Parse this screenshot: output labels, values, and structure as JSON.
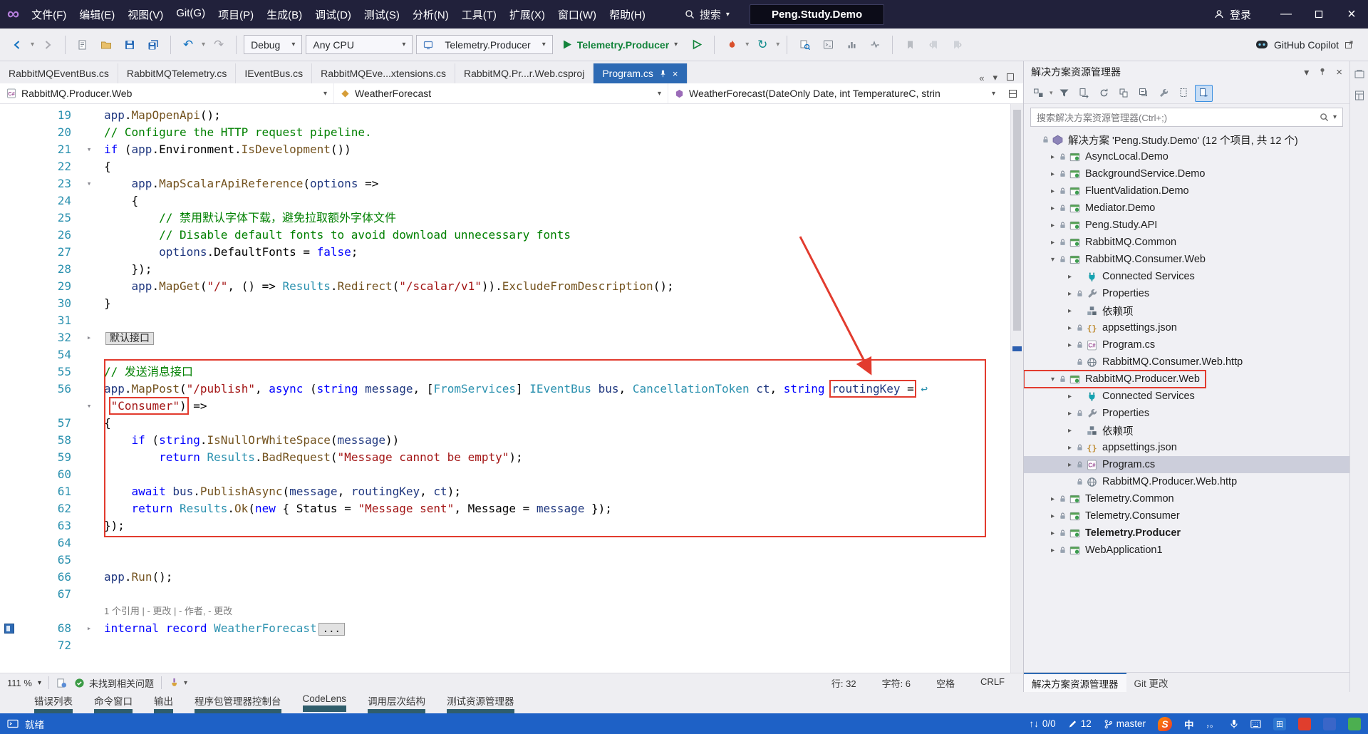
{
  "title_bar": {
    "menus": [
      "文件(F)",
      "编辑(E)",
      "视图(V)",
      "Git(G)",
      "项目(P)",
      "生成(B)",
      "调试(D)",
      "测试(S)",
      "分析(N)",
      "工具(T)",
      "扩展(X)",
      "窗口(W)",
      "帮助(H)"
    ],
    "search_label": "搜索",
    "solution_badge": "Peng.Study.Demo",
    "sign_in_label": "登录"
  },
  "toolbar": {
    "configuration": "Debug",
    "platform": "Any CPU",
    "profile": "Telemetry.Producer",
    "start_label": "Telemetry.Producer",
    "copilot_label": "GitHub Copilot"
  },
  "document_tabs": [
    {
      "label": "RabbitMQEventBus.cs"
    },
    {
      "label": "RabbitMQTelemetry.cs"
    },
    {
      "label": "IEventBus.cs"
    },
    {
      "label": "RabbitMQEve...xtensions.cs"
    },
    {
      "label": "RabbitMQ.Pr...r.Web.csproj"
    },
    {
      "label": "Program.cs",
      "active": true
    }
  ],
  "navbar": {
    "project": "RabbitMQ.Producer.Web",
    "type": "WeatherForecast",
    "member": "WeatherForecast(DateOnly Date, int TemperatureC, strin"
  },
  "editor": {
    "lines": [
      {
        "n": "19",
        "t": [
          [
            "v",
            "app"
          ],
          [
            "pl",
            "."
          ],
          [
            "m",
            "MapOpenApi"
          ],
          [
            "pl",
            "();"
          ]
        ]
      },
      {
        "n": "20",
        "t": [
          [
            "c",
            "// Configure the HTTP request pipeline."
          ]
        ]
      },
      {
        "n": "21",
        "f": "e",
        "t": [
          [
            "k",
            "if"
          ],
          [
            "pl",
            " ("
          ],
          [
            "v",
            "app"
          ],
          [
            "pl",
            ".Environment."
          ],
          [
            "m",
            "IsDevelopment"
          ],
          [
            "pl",
            "())"
          ]
        ]
      },
      {
        "n": "22",
        "t": [
          [
            "pl",
            "{"
          ]
        ]
      },
      {
        "n": "23",
        "f": "e",
        "t": [
          [
            "pl",
            "    "
          ],
          [
            "v",
            "app"
          ],
          [
            "pl",
            "."
          ],
          [
            "m",
            "MapScalarApiReference"
          ],
          [
            "pl",
            "("
          ],
          [
            "v",
            "options"
          ],
          [
            "pl",
            " =>"
          ]
        ]
      },
      {
        "n": "24",
        "t": [
          [
            "pl",
            "    {"
          ]
        ]
      },
      {
        "n": "25",
        "t": [
          [
            "pl",
            "        "
          ],
          [
            "c",
            "// 禁用默认字体下载，避免拉取额外字体文件"
          ]
        ]
      },
      {
        "n": "26",
        "t": [
          [
            "pl",
            "        "
          ],
          [
            "c",
            "// Disable default fonts to avoid download unnecessary fonts"
          ]
        ]
      },
      {
        "n": "27",
        "t": [
          [
            "pl",
            "        "
          ],
          [
            "v",
            "options"
          ],
          [
            "pl",
            ".DefaultFonts = "
          ],
          [
            "k",
            "false"
          ],
          [
            "pl",
            ";"
          ]
        ]
      },
      {
        "n": "28",
        "t": [
          [
            "pl",
            "    });"
          ]
        ]
      },
      {
        "n": "29",
        "t": [
          [
            "pl",
            "    "
          ],
          [
            "v",
            "app"
          ],
          [
            "pl",
            "."
          ],
          [
            "m",
            "MapGet"
          ],
          [
            "pl",
            "("
          ],
          [
            "s",
            "\"/\""
          ],
          [
            "pl",
            ", () => "
          ],
          [
            "t",
            "Results"
          ],
          [
            "pl",
            "."
          ],
          [
            "m",
            "Redirect"
          ],
          [
            "pl",
            "("
          ],
          [
            "s",
            "\"/scalar/v1\""
          ],
          [
            "pl",
            "))."
          ],
          [
            "m",
            "ExcludeFromDescription"
          ],
          [
            "pl",
            "();"
          ]
        ]
      },
      {
        "n": "30",
        "t": [
          [
            "pl",
            "}"
          ]
        ]
      },
      {
        "n": "31",
        "t": []
      },
      {
        "n": "32",
        "f": "c",
        "t": [
          [
            "collapsed",
            "默认接口"
          ]
        ]
      },
      {
        "n": "54",
        "t": []
      },
      {
        "n": "55",
        "t": [
          [
            "c",
            "// 发送消息接口"
          ]
        ]
      },
      {
        "n": "56",
        "t": [
          [
            "v",
            "app"
          ],
          [
            "pl",
            "."
          ],
          [
            "m",
            "MapPost"
          ],
          [
            "pl",
            "("
          ],
          [
            "s",
            "\"/publish\""
          ],
          [
            "pl",
            ", "
          ],
          [
            "k",
            "async"
          ],
          [
            "pl",
            " ("
          ],
          [
            "k",
            "string"
          ],
          [
            "pl",
            " "
          ],
          [
            "v",
            "message"
          ],
          [
            "pl",
            ", ["
          ],
          [
            "t",
            "FromServices"
          ],
          [
            "pl",
            "] "
          ],
          [
            "t",
            "IEventBus"
          ],
          [
            "pl",
            " "
          ],
          [
            "v",
            "bus"
          ],
          [
            "pl",
            ", "
          ],
          [
            "t",
            "CancellationToken"
          ],
          [
            "pl",
            " "
          ],
          [
            "v",
            "ct"
          ],
          [
            "pl",
            ", "
          ],
          [
            "k",
            "string"
          ],
          [
            "pl",
            " "
          ],
          [
            "BOX",
            [
              [
                "v",
                "routingKey"
              ],
              [
                "pl",
                " ="
              ]
            ]
          ],
          [
            "wr",
            " ↩"
          ]
        ]
      },
      {
        "n": "",
        "f": "e",
        "t": [
          [
            "pl",
            " "
          ],
          [
            "BOX",
            [
              [
                "s",
                "\"Consumer\""
              ],
              [
                "pl",
                ")"
              ]
            ]
          ],
          [
            "pl",
            " =>"
          ]
        ]
      },
      {
        "n": "57",
        "t": [
          [
            "pl",
            "{"
          ]
        ]
      },
      {
        "n": "58",
        "t": [
          [
            "pl",
            "    "
          ],
          [
            "k",
            "if"
          ],
          [
            "pl",
            " ("
          ],
          [
            "k",
            "string"
          ],
          [
            "pl",
            "."
          ],
          [
            "m",
            "IsNullOrWhiteSpace"
          ],
          [
            "pl",
            "("
          ],
          [
            "v",
            "message"
          ],
          [
            "pl",
            "))"
          ]
        ]
      },
      {
        "n": "59",
        "t": [
          [
            "pl",
            "        "
          ],
          [
            "k",
            "return"
          ],
          [
            "pl",
            " "
          ],
          [
            "t",
            "Results"
          ],
          [
            "pl",
            "."
          ],
          [
            "m",
            "BadRequest"
          ],
          [
            "pl",
            "("
          ],
          [
            "s",
            "\"Message cannot be empty\""
          ],
          [
            "pl",
            ");"
          ]
        ]
      },
      {
        "n": "60",
        "t": []
      },
      {
        "n": "61",
        "t": [
          [
            "pl",
            "    "
          ],
          [
            "k",
            "await"
          ],
          [
            "pl",
            " "
          ],
          [
            "v",
            "bus"
          ],
          [
            "pl",
            "."
          ],
          [
            "m",
            "PublishAsync"
          ],
          [
            "pl",
            "("
          ],
          [
            "v",
            "message"
          ],
          [
            "pl",
            ", "
          ],
          [
            "v",
            "routingKey"
          ],
          [
            "pl",
            ", "
          ],
          [
            "v",
            "ct"
          ],
          [
            "pl",
            ");"
          ]
        ]
      },
      {
        "n": "62",
        "t": [
          [
            "pl",
            "    "
          ],
          [
            "k",
            "return"
          ],
          [
            "pl",
            " "
          ],
          [
            "t",
            "Results"
          ],
          [
            "pl",
            "."
          ],
          [
            "m",
            "Ok"
          ],
          [
            "pl",
            "("
          ],
          [
            "k",
            "new"
          ],
          [
            "pl",
            " { Status = "
          ],
          [
            "s",
            "\"Message sent\""
          ],
          [
            "pl",
            ", Message = "
          ],
          [
            "v",
            "message"
          ],
          [
            "pl",
            " });"
          ]
        ]
      },
      {
        "n": "63",
        "t": [
          [
            "pl",
            "});"
          ]
        ]
      },
      {
        "n": "64",
        "t": []
      },
      {
        "n": "65",
        "t": []
      },
      {
        "n": "66",
        "t": [
          [
            "v",
            "app"
          ],
          [
            "pl",
            "."
          ],
          [
            "m",
            "Run"
          ],
          [
            "pl",
            "();"
          ]
        ]
      },
      {
        "n": "67",
        "t": []
      },
      {
        "lens": "1 个引用 | - 更改 | - 作者, - 更改"
      },
      {
        "n": "68",
        "f": "c",
        "mark": true,
        "t": [
          [
            "k",
            "internal"
          ],
          [
            "pl",
            " "
          ],
          [
            "k",
            "record"
          ],
          [
            "pl",
            " "
          ],
          [
            "t",
            "WeatherForecast"
          ],
          [
            "collapsed",
            "..."
          ]
        ]
      },
      {
        "n": "72",
        "t": []
      }
    ]
  },
  "editor_status": {
    "zoom": "111 %",
    "health": "未找到相关问题",
    "line": "行: 32",
    "column": "字符: 6",
    "spaces": "空格",
    "line_ending": "CRLF"
  },
  "solution_explorer": {
    "title": "解决方案资源管理器",
    "search_placeholder": "搜索解决方案资源管理器(Ctrl+;)",
    "tree": [
      {
        "label": "解决方案 'Peng.Study.Demo' (12 个项目, 共 12 个)",
        "icon": "solution",
        "indent": 0,
        "arrow": "",
        "lock": true
      },
      {
        "label": "AsyncLocal.Demo",
        "icon": "project",
        "indent": 1,
        "arrow": "c",
        "lock": true
      },
      {
        "label": "BackgroundService.Demo",
        "icon": "project",
        "indent": 1,
        "arrow": "c",
        "lock": true
      },
      {
        "label": "FluentValidation.Demo",
        "icon": "project",
        "indent": 1,
        "arrow": "c",
        "lock": true
      },
      {
        "label": "Mediator.Demo",
        "icon": "project",
        "indent": 1,
        "arrow": "c",
        "lock": true
      },
      {
        "label": "Peng.Study.API",
        "icon": "project",
        "indent": 1,
        "arrow": "c",
        "lock": true
      },
      {
        "label": "RabbitMQ.Common",
        "icon": "project",
        "indent": 1,
        "arrow": "c",
        "lock": true
      },
      {
        "label": "RabbitMQ.Consumer.Web",
        "icon": "project",
        "indent": 1,
        "arrow": "e",
        "lock": true
      },
      {
        "label": "Connected Services",
        "icon": "plug",
        "indent": 2,
        "arrow": "c",
        "lock": false
      },
      {
        "label": "Properties",
        "icon": "wrench",
        "indent": 2,
        "arrow": "c",
        "lock": true
      },
      {
        "label": "依赖项",
        "icon": "dep",
        "indent": 2,
        "arrow": "c",
        "lock": false
      },
      {
        "label": "appsettings.json",
        "icon": "json",
        "indent": 2,
        "arrow": "c",
        "lock": true
      },
      {
        "label": "Program.cs",
        "icon": "cs",
        "indent": 2,
        "arrow": "c",
        "lock": true
      },
      {
        "label": "RabbitMQ.Consumer.Web.http",
        "icon": "http",
        "indent": 2,
        "arrow": "",
        "lock": true
      },
      {
        "label": "RabbitMQ.Producer.Web",
        "icon": "project",
        "indent": 1,
        "arrow": "e",
        "lock": true,
        "boxed": true
      },
      {
        "label": "Connected Services",
        "icon": "plug",
        "indent": 2,
        "arrow": "c",
        "lock": false
      },
      {
        "label": "Properties",
        "icon": "wrench",
        "indent": 2,
        "arrow": "c",
        "lock": true
      },
      {
        "label": "依赖项",
        "icon": "dep",
        "indent": 2,
        "arrow": "c",
        "lock": false
      },
      {
        "label": "appsettings.json",
        "icon": "json",
        "indent": 2,
        "arrow": "c",
        "lock": true
      },
      {
        "label": "Program.cs",
        "icon": "cs",
        "indent": 2,
        "arrow": "c",
        "lock": true,
        "selected": true
      },
      {
        "label": "RabbitMQ.Producer.Web.http",
        "icon": "http",
        "indent": 2,
        "arrow": "",
        "lock": true
      },
      {
        "label": "Telemetry.Common",
        "icon": "project",
        "indent": 1,
        "arrow": "c",
        "lock": true
      },
      {
        "label": "Telemetry.Consumer",
        "icon": "project",
        "indent": 1,
        "arrow": "c",
        "lock": true
      },
      {
        "label": "Telemetry.Producer",
        "icon": "project",
        "indent": 1,
        "arrow": "c",
        "lock": true,
        "bold": true
      },
      {
        "label": "WebApplication1",
        "icon": "project",
        "indent": 1,
        "arrow": "c",
        "lock": true
      }
    ],
    "tabs": [
      {
        "label": "解决方案资源管理器",
        "active": true
      },
      {
        "label": "Git 更改"
      }
    ]
  },
  "bottom_panel_tabs": [
    "错误列表",
    "命令窗口",
    "输出",
    "程序包管理器控制台",
    "CodeLens",
    "调用层次结构",
    "测试资源管理器"
  ],
  "status_bar": {
    "ready": "就绪",
    "sync_count": "0/0",
    "pending_edits": "12",
    "branch": "master",
    "ime_mode": "中"
  },
  "colors": {
    "active_tab": "#2D6AB4",
    "annotation_red": "#E23B2E",
    "status_bar_blue": "#1E61C6"
  }
}
